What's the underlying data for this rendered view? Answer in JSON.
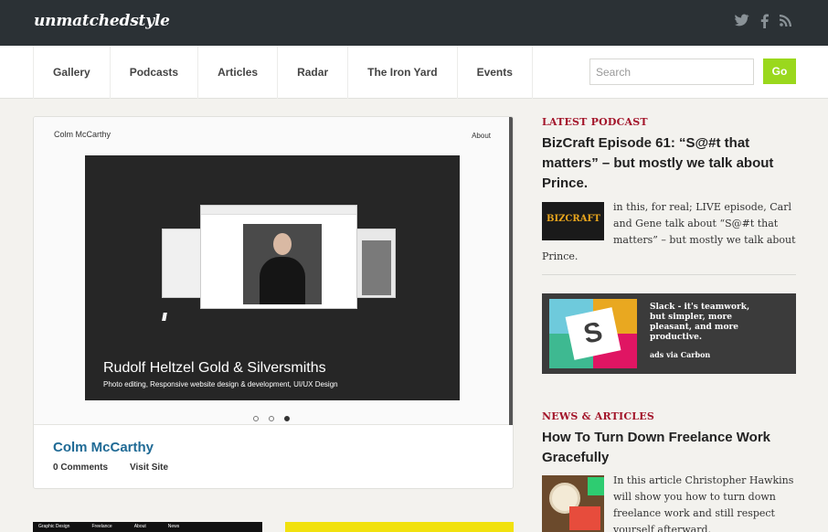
{
  "site": {
    "logo": "unmatchedstyle",
    "social_icons": [
      "twitter-icon",
      "facebook-icon",
      "rss-icon"
    ]
  },
  "nav": {
    "items": [
      "Gallery",
      "Podcasts",
      "Articles",
      "Radar",
      "The Iron Yard",
      "Events"
    ]
  },
  "search": {
    "placeholder": "Search",
    "button": "Go"
  },
  "colors": {
    "topbar": "#2b3135",
    "go_button": "#9ad81d",
    "kicker": "#a3152a",
    "link": "#1f6a95"
  },
  "featured": {
    "screenshot_name": "Colm McCarthy",
    "screenshot_about": "About",
    "screenshot_title": "Rudolf Heltzel Gold & Silversmiths",
    "screenshot_subtitle": "Photo editing, Responsive website design & development, UI/UX Design",
    "logo_mark": "///",
    "carousel_total": 3,
    "carousel_active": 3,
    "title": "Colm McCarthy",
    "comments": "0 Comments",
    "visit": "Visit Site"
  },
  "podcast": {
    "kicker": "LATEST PODCAST",
    "title": "BizCraft Episode 61: “S@#t that matters” – but mostly we talk about Prince.",
    "thumb_label": "BIZCRAFT",
    "body": "in this, for real; LIVE episode, Carl and Gene talk about “S@#t that matters” – but mostly we talk about Prince."
  },
  "ad": {
    "text": "Slack - it's teamwork, but simpler, more pleasant, and more productive.",
    "via": "ads via Carbon",
    "logo_letter": "S"
  },
  "news": {
    "kicker": "NEWS & ARTICLES",
    "title": "How To Turn Down Freelance Work Gracefully",
    "body": "In this article Christopher Hawkins will show you how to turn down freelance work and still respect yourself afterward."
  },
  "bottom_strip": {
    "left_labels": [
      "Graphic Design",
      "Freelance",
      "About",
      "News"
    ]
  }
}
